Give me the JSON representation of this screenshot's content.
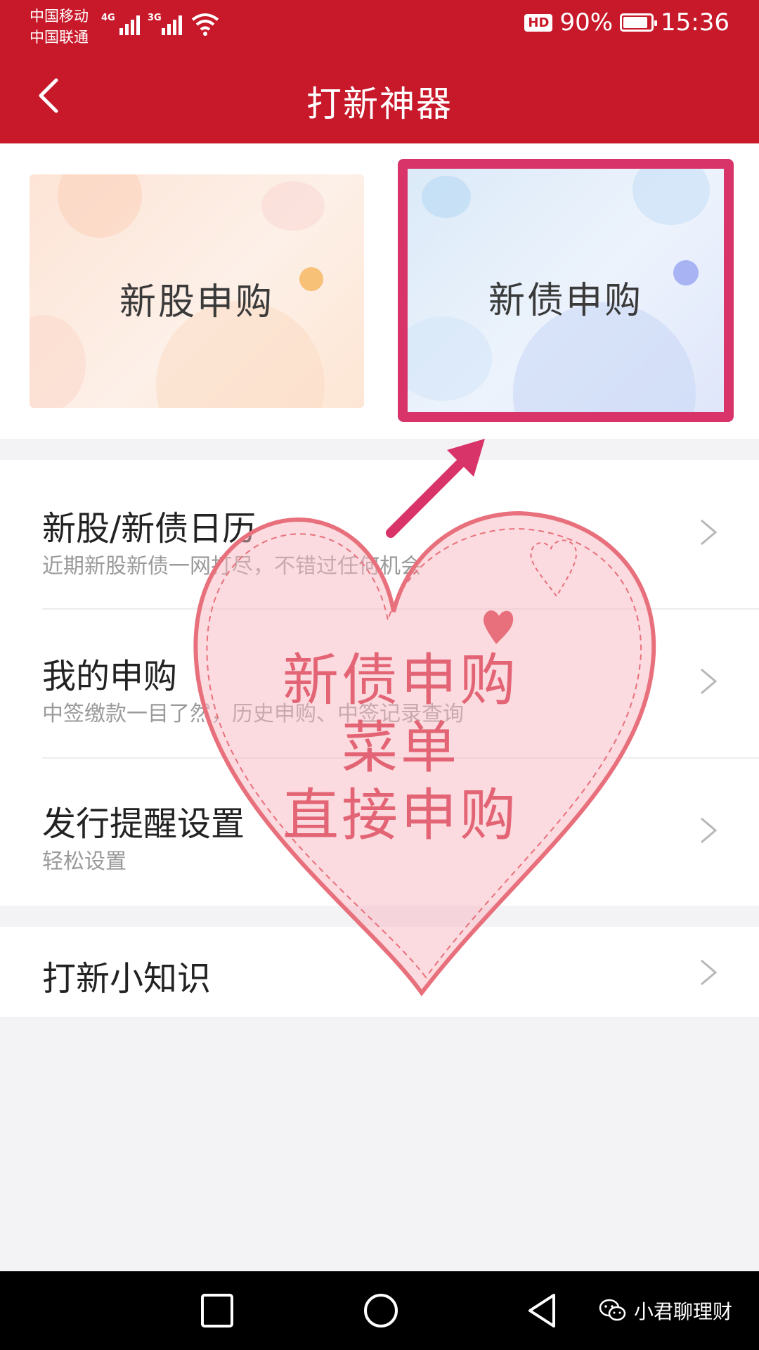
{
  "status": {
    "carrier1": "中国移动",
    "carrier2": "中国联通",
    "net1": "4G",
    "net2": "3G",
    "hd": "HD",
    "battery": "90%",
    "battery_level": 0.9,
    "time": "15:36"
  },
  "header": {
    "title": "打新神器"
  },
  "cards": {
    "stock": {
      "label": "新股申购"
    },
    "bond": {
      "label": "新债申购"
    }
  },
  "list": [
    {
      "title": "新股/新债日历",
      "subtitle": "近期新股新债一网打尽，不错过任何机会"
    },
    {
      "title": "我的申购",
      "subtitle": "中签缴款一目了然，历史申购、中签记录查询"
    },
    {
      "title": "发行提醒设置",
      "subtitle": "轻松设置"
    },
    {
      "title": "打新小知识"
    }
  ],
  "annotation": {
    "line1": "新债申购",
    "line2": "菜单",
    "line3": "直接申购",
    "color": "#e05466",
    "arrow_color": "#d8346a"
  },
  "watermark": {
    "text": "小君聊理财",
    "icon": "wechat-icon"
  },
  "colors": {
    "header_bg": "#c8192a",
    "highlight": "#d8346a"
  }
}
